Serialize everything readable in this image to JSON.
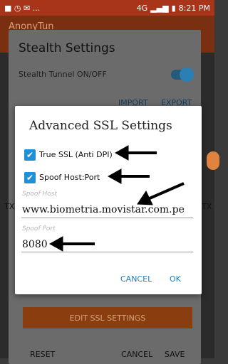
{
  "statusbar": {
    "left_icons": "■ ◷ ✉ ...",
    "time": "8:21 PM",
    "network": "4G"
  },
  "app": {
    "title": "AnonyTun"
  },
  "background_dialog": {
    "title": "Stealth Settings",
    "tunnel_label": "Stealth Tunnel ON/OFF",
    "import_label": "IMPORT",
    "export_label": "EXPORT",
    "tx_left": "TX",
    "tx_right": "TX",
    "edit_button": "EDIT SSL SETTINGS",
    "bottom_left": "RESET",
    "bottom_mid": "CANCEL",
    "bottom_right": "SAVE"
  },
  "dialog": {
    "title": "Advanced SSL Settings",
    "checkbox_true_ssl": {
      "label": "True SSL (Anti DPI)",
      "checked": true
    },
    "checkbox_spoof_host": {
      "label": "Spoof Host:Port",
      "checked": true
    },
    "spoof_host": {
      "label": "Spoof Host",
      "value": "www.biometria.movistar.com.pe"
    },
    "spoof_port": {
      "label": "Spoof Port",
      "value": "8080"
    },
    "cancel_label": "CANCEL",
    "ok_label": "OK"
  },
  "colors": {
    "accent": "#1f8fd6",
    "statusbar": "#a8351a"
  }
}
